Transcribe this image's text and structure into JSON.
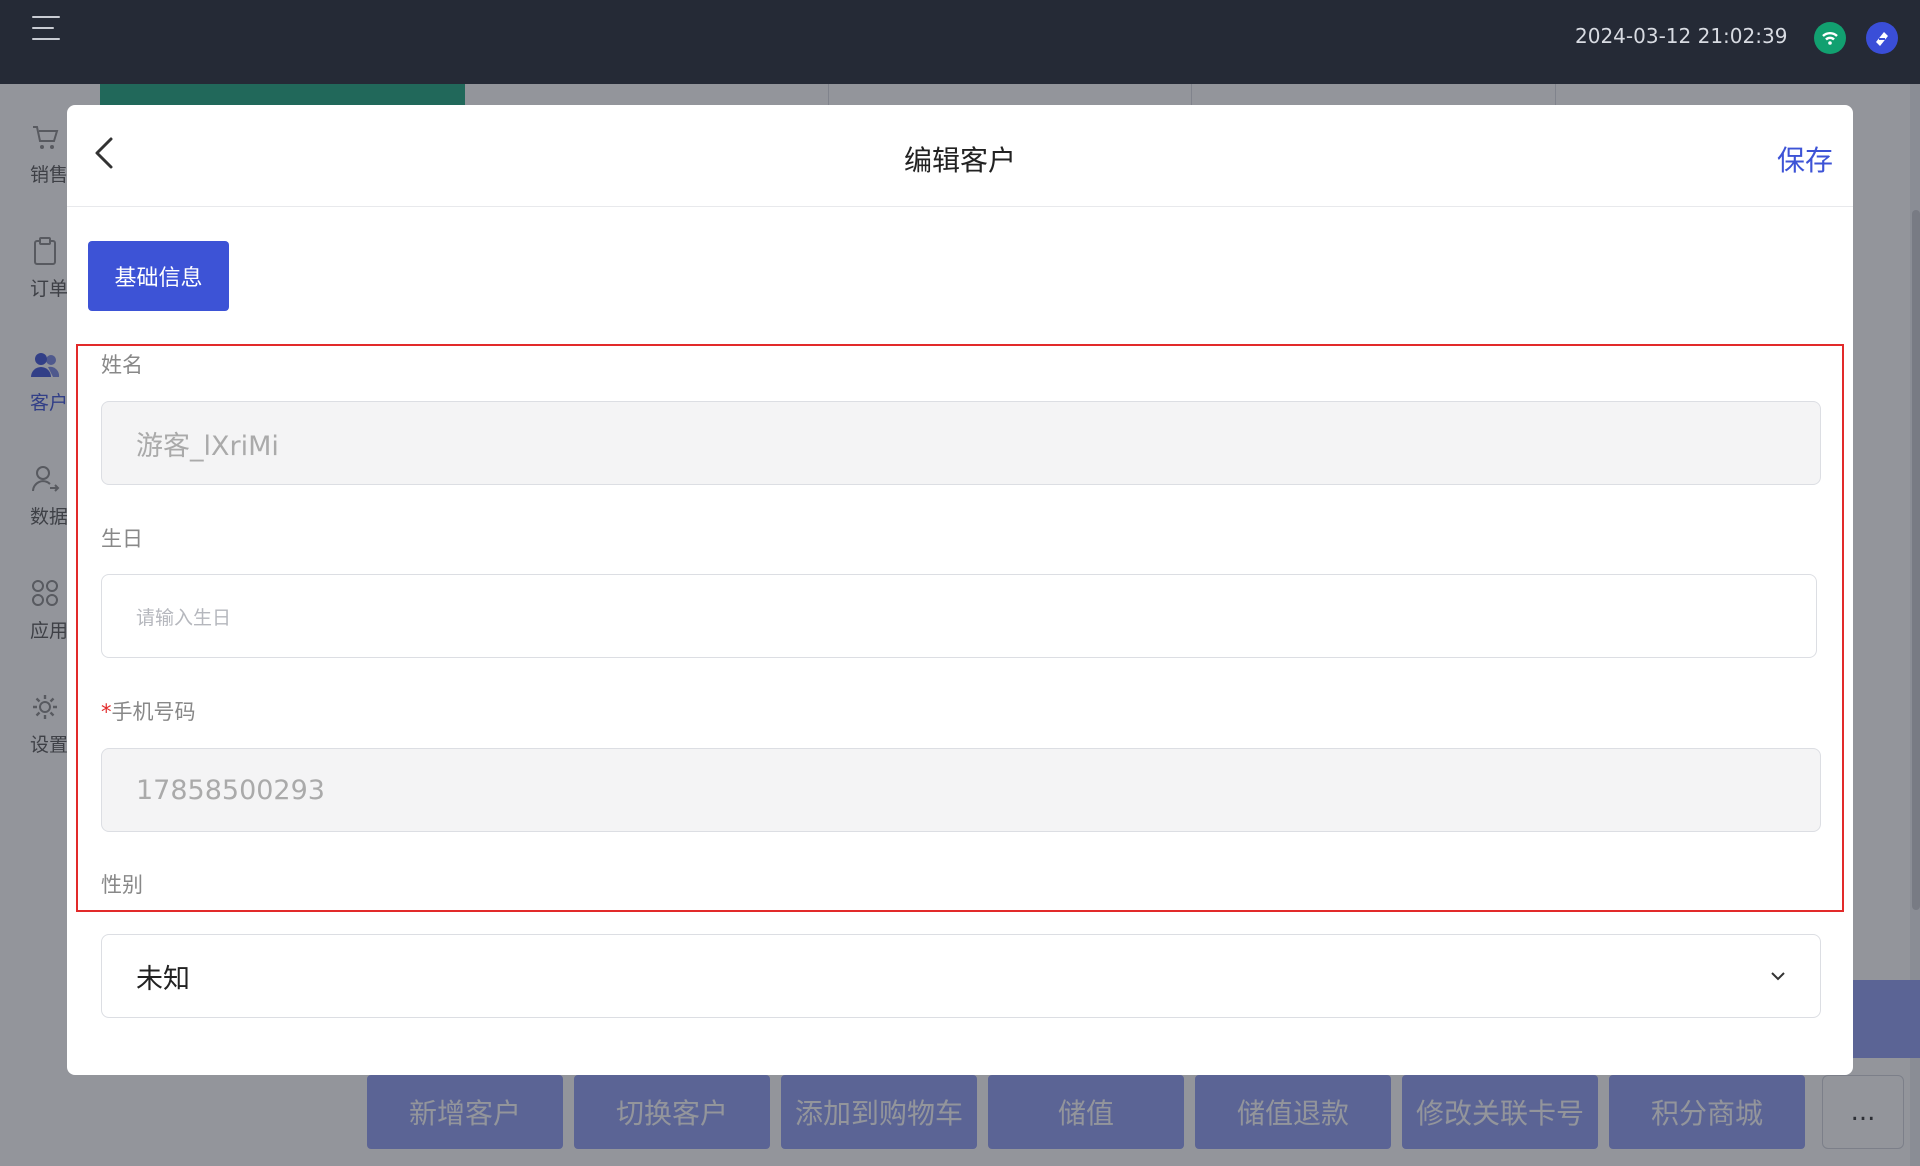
{
  "topbar": {
    "datetime": "2024-03-12 21:02:39",
    "icons": [
      "menu-icon",
      "wifi-icon",
      "brand-icon"
    ]
  },
  "sidebar": {
    "items": [
      {
        "label": "销售",
        "icon": "cart-icon"
      },
      {
        "label": "订单",
        "icon": "clipboard-icon"
      },
      {
        "label": "客户",
        "icon": "users-icon",
        "active": true
      },
      {
        "label": "数据",
        "icon": "user-arrow-icon"
      },
      {
        "label": "应用",
        "icon": "apps-icon"
      },
      {
        "label": "设置",
        "icon": "gear-icon"
      }
    ]
  },
  "bottom_actions": {
    "buttons": [
      "新增客户",
      "切换客户",
      "添加到购物车",
      "储值",
      "储值退款",
      "修改关联卡号",
      "积分商城"
    ],
    "more": "..."
  },
  "modal": {
    "title": "编辑客户",
    "save": "保存",
    "tab": "基础信息",
    "fields": {
      "name": {
        "label": "姓名",
        "value": "游客_lXriMi"
      },
      "birthday": {
        "label": "生日",
        "placeholder": "请输入生日"
      },
      "phone": {
        "required_mark": "*",
        "label": "手机号码",
        "value": "17858500293"
      },
      "gender": {
        "label": "性别",
        "value": "未知"
      }
    }
  },
  "colors": {
    "accent": "#3d53d6",
    "topbar": "#252a36",
    "highlight": "#e22a2a",
    "wifi": "#12a070"
  }
}
